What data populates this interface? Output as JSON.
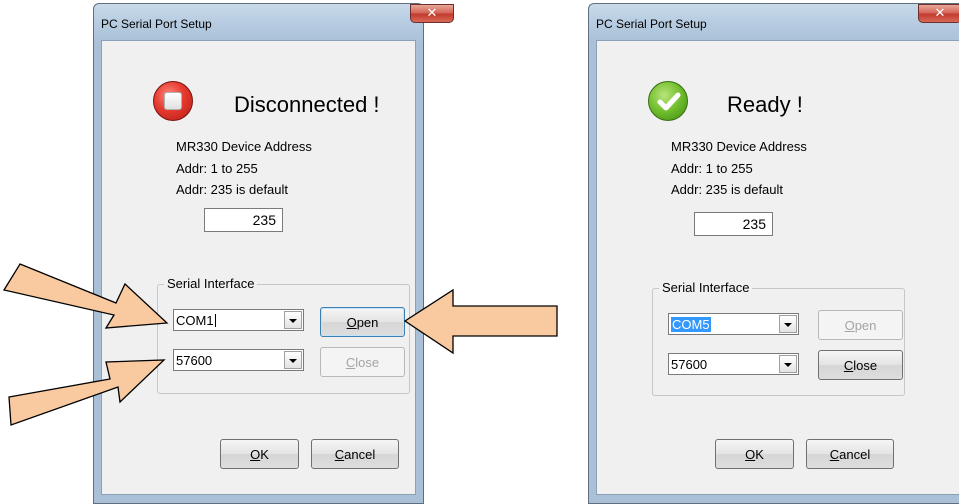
{
  "dialogs": {
    "left": {
      "title": "PC Serial Port Setup",
      "status_text": "Disconnected !",
      "status_icon": "stop-icon",
      "device_label": "MR330 Device Address",
      "addr_range": "Addr: 1 to 255",
      "addr_default": "Addr: 235 is default",
      "address_value": "235",
      "group_label": "Serial Interface",
      "port_value": "COM1",
      "baud_value": "57600",
      "open_label": "Open",
      "open_enabled": true,
      "close_label": "Close",
      "close_enabled": false,
      "ok_label": "OK",
      "cancel_label": "Cancel"
    },
    "right": {
      "title": "PC Serial Port Setup",
      "status_text": "Ready !",
      "status_icon": "check-icon",
      "device_label": "MR330 Device Address",
      "addr_range": "Addr: 1 to 255",
      "addr_default": "Addr: 235 is default",
      "address_value": "235",
      "group_label": "Serial Interface",
      "port_value": "COM5",
      "baud_value": "57600",
      "open_label": "Open",
      "open_enabled": false,
      "close_label": "Close",
      "close_enabled": true,
      "ok_label": "OK",
      "cancel_label": "Cancel"
    }
  },
  "colors": {
    "arrow_fill": "#f9c9a0",
    "arrow_stroke": "#000000",
    "selection": "#3399ff",
    "close_button": "#c23b2e"
  }
}
